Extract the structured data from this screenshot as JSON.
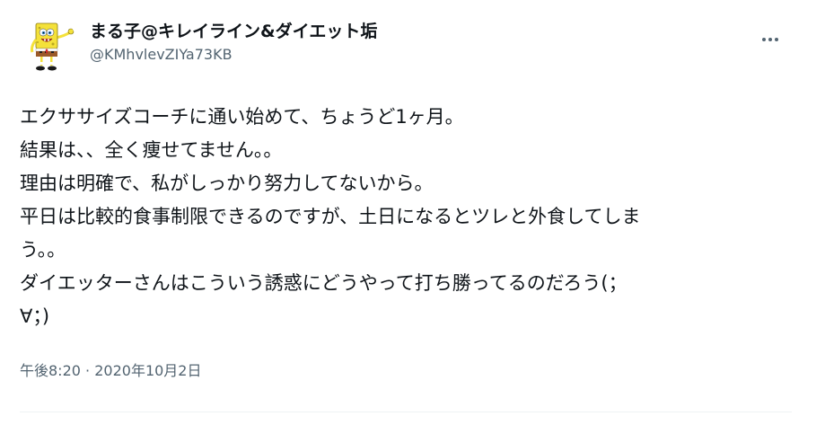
{
  "author": {
    "display_name": "まる子@キレイライン&ダイエット垢",
    "handle": "@KMhvlevZIYa73KB",
    "avatar_icon": "sponge-character-avatar-icon"
  },
  "more_icon": "more-options-icon",
  "tweet": {
    "lines": [
      "エクササイズコーチに通い始めて、ちょうど1ヶ月。",
      "結果は、、全く痩せてません。。",
      "理由は明確で、私がしっかり努力してないから。",
      "平日は比較的食事制限できるのですが、土日になるとツレと外食してしま",
      "う。。",
      "ダイエッターさんはこういう誘惑にどうやって打ち勝ってるのだろう(；",
      "∀；)"
    ]
  },
  "meta": {
    "time": "午後8:20",
    "separator": "·",
    "date": "2020年10月2日"
  },
  "colors": {
    "text_primary": "#0f1419",
    "text_secondary": "#536471",
    "divider": "#eff3f4",
    "avatar_yellow": "#f4e13a"
  }
}
